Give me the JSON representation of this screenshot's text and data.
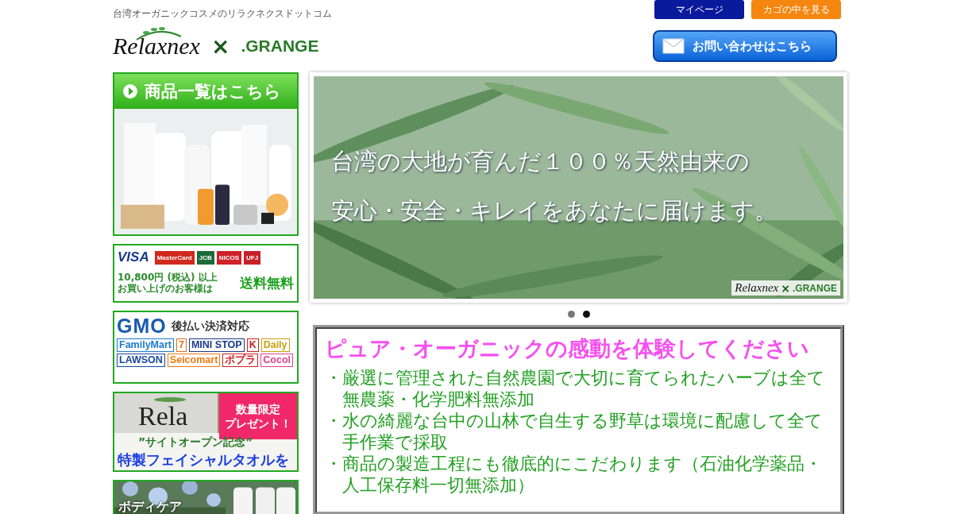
{
  "header": {
    "tagline": "台湾オーガニックコスメのリラクネクスドットコム",
    "logo": {
      "brand_1": "Relaxnex",
      "separator": "×",
      "brand_2": ".GRANGE"
    },
    "nav_buttons": [
      {
        "label": "マイページ",
        "kind": "mypage"
      },
      {
        "label": "カゴの中を見る",
        "kind": "cart"
      }
    ],
    "contact_button": {
      "label": "お問い合わせはこちら"
    }
  },
  "sidebar": {
    "banners": [
      {
        "kind": "products",
        "title": "商品一覧はこちら"
      },
      {
        "kind": "payment",
        "cards": [
          {
            "label": "VISA",
            "color": "#1a3a8c"
          },
          {
            "label": "MasterCard",
            "color": "#d0281c"
          },
          {
            "label": "JCB",
            "color": "#1b6b3a"
          },
          {
            "label": "NICOS",
            "color": "#d0202a"
          },
          {
            "label": "UFJ",
            "color": "#c8202a"
          }
        ],
        "threshold": "10,800円 (税込) 以上",
        "note": "お買い上げのお客様は",
        "headline": "送料無料"
      },
      {
        "kind": "deferred",
        "logo": "GMO",
        "headline": "後払い決済対応",
        "stores": [
          {
            "label": "FamilyMart",
            "color": "#1a7ad0"
          },
          {
            "label": "7",
            "color": "#e0701a"
          },
          {
            "label": "MINI STOP",
            "color": "#1a3a8c"
          },
          {
            "label": "K",
            "color": "#d0201a"
          },
          {
            "label": "Daily",
            "color": "#c8a010"
          },
          {
            "label": "LAWSON",
            "color": "#1a4aa0"
          },
          {
            "label": "Seicomart",
            "color": "#f07a10"
          },
          {
            "label": "ポプラ",
            "color": "#d02020"
          },
          {
            "label": "Cocol",
            "color": "#e0408a"
          }
        ]
      },
      {
        "kind": "present",
        "towel_text": "Rela",
        "ribbon_lines": [
          "数量限定",
          "プレゼント！"
        ],
        "subtitle": "”サイトオープン記念”",
        "headline": "特製フェイシャルタオルを"
      },
      {
        "kind": "bodycare",
        "headline": "ボディケア"
      }
    ]
  },
  "hero": {
    "lines": [
      "台湾の大地が育んだ１００％天然由来の",
      "安心・安全・キレイをあなたに届けます。"
    ],
    "logo": {
      "brand_1": "Relaxnex",
      "separator": "×",
      "brand_2": ".GRANGE"
    },
    "dots": [
      {
        "selected": false
      },
      {
        "selected": true
      }
    ]
  },
  "features": {
    "title": "ピュア・オーガニックの感動を体験してください",
    "items": [
      "・厳選に管理された自然農園で大切に育てられたハーブは全て無農薬・化学肥料無添加",
      "・水の綺麗な台中の山林で自生する野草は環境に配慮して全て手作業で採取",
      "・商品の製造工程にも徹底的にこだわります（石油化学薬品・人工保存料一切無添加）"
    ]
  }
}
